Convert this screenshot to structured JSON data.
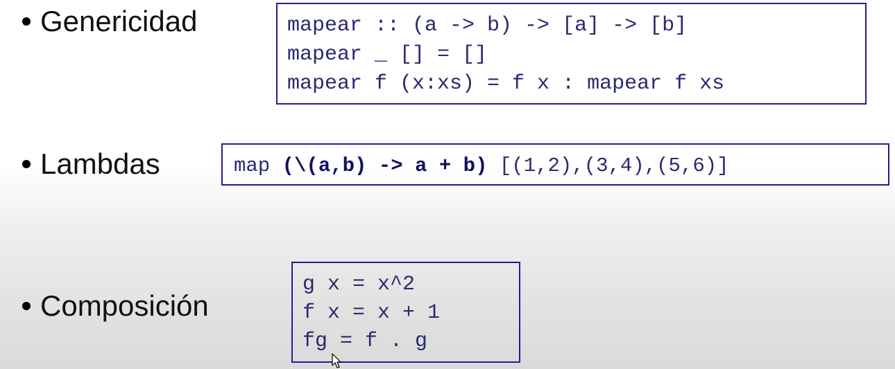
{
  "sections": [
    {
      "label": "Genericidad",
      "code": [
        "mapear :: (a -> b) -> [a] -> [b]",
        "mapear _ [] = []",
        "mapear f (x:xs) = f x : mapear f xs"
      ]
    },
    {
      "label": "Lambdas",
      "code_parts": {
        "prefix": "map ",
        "lambda": "(\\(a,b) -> a + b)",
        "suffix": " [(1,2),(3,4),(5,6)]"
      }
    },
    {
      "label": "Composición",
      "code": [
        "g x = x^2",
        "f x = x + 1",
        "fg = f . g"
      ]
    }
  ],
  "colors": {
    "code_text": "#2a2a6e",
    "code_border": "#1f1f8f",
    "label_text": "#111111"
  },
  "icons": [
    "bullet-dot",
    "mouse-cursor-icon"
  ]
}
